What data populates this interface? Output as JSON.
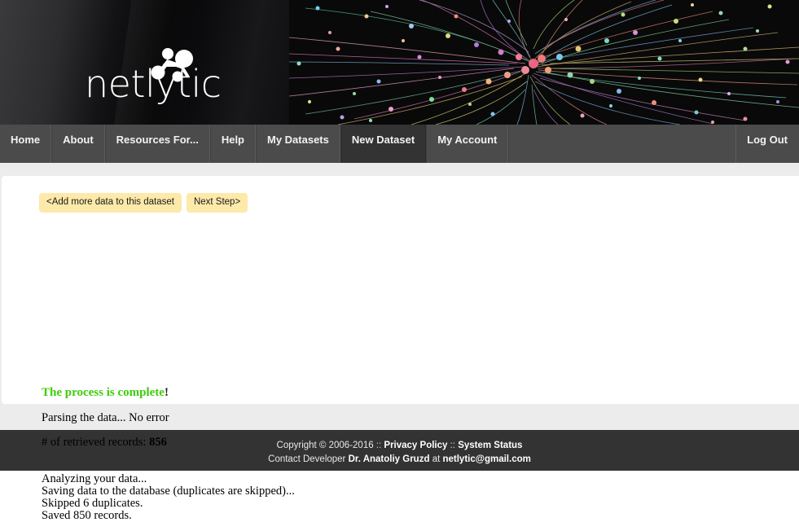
{
  "site": {
    "logo_text": "netlytic",
    "logo_icon": "network-nodes-icon"
  },
  "nav": {
    "items": [
      {
        "label": "Home",
        "active": false
      },
      {
        "label": "About",
        "active": false
      },
      {
        "label": "Resources For...",
        "active": false
      },
      {
        "label": "Help",
        "active": false
      },
      {
        "label": "My Datasets",
        "active": false
      },
      {
        "label": "New Dataset",
        "active": true
      },
      {
        "label": "My Account",
        "active": false
      }
    ],
    "logout_label": "Log Out"
  },
  "main": {
    "buttons": [
      {
        "label": "<Add more data to this dataset"
      },
      {
        "label": "Next Step>"
      }
    ],
    "status_text": "The process is complete",
    "status_suffix": "!",
    "log": [
      "Parsing the data... No error",
      "",
      "# of retrieved records: ",
      "",
      "Analyzing your data...",
      "Saving data to the database (duplicates are skipped)...",
      "Skipped 6 duplicates.",
      "Saved 850 records."
    ],
    "parsing_line": "Parsing the data... No error",
    "records_label": "# of retrieved records:",
    "records_count": "856",
    "analyzing_line": "Analyzing your data...",
    "saving_line": "Saving data to the database (duplicates are skipped)...",
    "skipped_line": "Skipped 6 duplicates.",
    "saved_line": "Saved 850 records."
  },
  "footer": {
    "copyright": "Copyright © 2006-2016",
    "sep1": "::",
    "privacy_policy": "Privacy Policy",
    "sep2": "::",
    "system_status": "System Status",
    "contact_prefix": "Contact Developer",
    "developer_name": "Dr. Anatoliy Gruzd",
    "contact_at": "at",
    "developer_email": "netlytic@gmail.com"
  },
  "colors": {
    "accent_green": "#3ecc0a",
    "button_yellow": "#fde9a9",
    "nav_bg": "#4b4b4b",
    "nav_active_bg": "#333333",
    "footer_bg": "#333333",
    "page_bg": "#ececec"
  }
}
